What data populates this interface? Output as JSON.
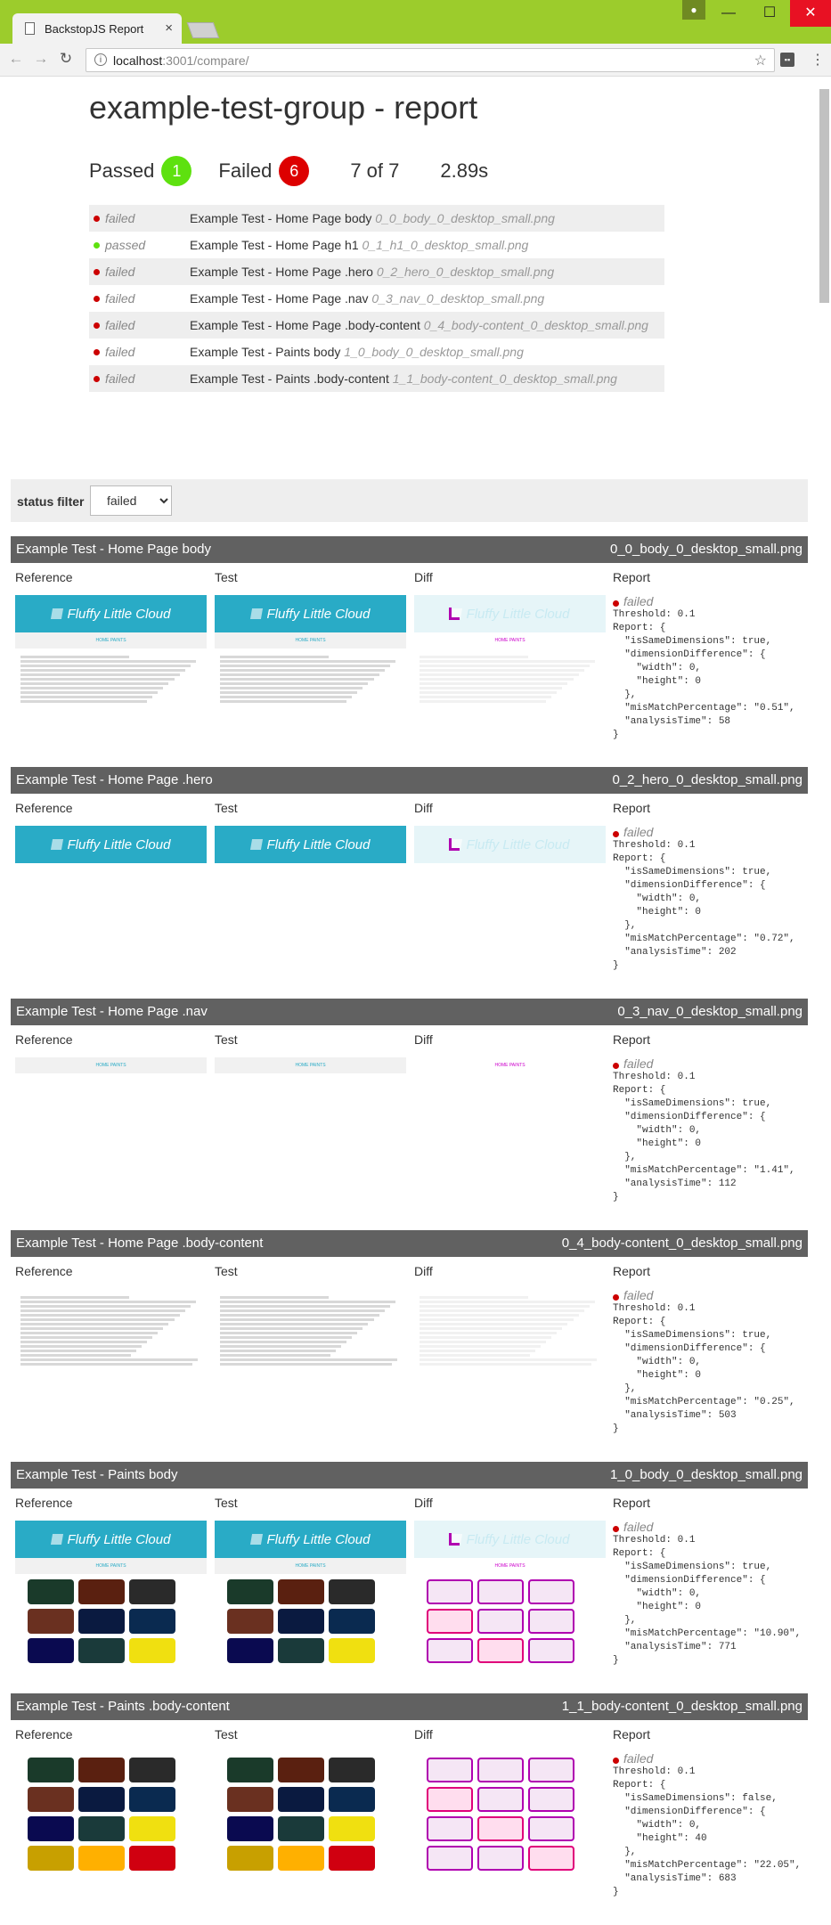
{
  "browser": {
    "tab_title": "BackstopJS Report",
    "url_host": "localhost",
    "url_path": ":3001/compare/"
  },
  "header": {
    "title": "example-test-group - report",
    "passed_label": "Passed",
    "passed_count": "1",
    "failed_label": "Failed",
    "failed_count": "6",
    "progress": "7 of 7",
    "time": "2.89s"
  },
  "summary_rows": [
    {
      "status": "failed",
      "name": "Example Test - Home Page body",
      "file": "0_0_body_0_desktop_small.png"
    },
    {
      "status": "passed",
      "name": "Example Test - Home Page h1",
      "file": "0_1_h1_0_desktop_small.png"
    },
    {
      "status": "failed",
      "name": "Example Test - Home Page .hero",
      "file": "0_2_hero_0_desktop_small.png"
    },
    {
      "status": "failed",
      "name": "Example Test - Home Page .nav",
      "file": "0_3_nav_0_desktop_small.png"
    },
    {
      "status": "failed",
      "name": "Example Test - Home Page .body-content",
      "file": "0_4_body-content_0_desktop_small.png"
    },
    {
      "status": "failed",
      "name": "Example Test - Paints body",
      "file": "1_0_body_0_desktop_small.png"
    },
    {
      "status": "failed",
      "name": "Example Test - Paints .body-content",
      "file": "1_1_body-content_0_desktop_small.png"
    }
  ],
  "filter": {
    "label": "status filter",
    "value": "failed"
  },
  "columns": {
    "reference": "Reference",
    "test": "Test",
    "diff": "Diff",
    "report": "Report"
  },
  "screenshot_texts": {
    "hero": "Fluffy Little Cloud",
    "nav": "HOME    PAINTS"
  },
  "tests": [
    {
      "name": "Example Test - Home Page body",
      "file": "0_0_body_0_desktop_small.png",
      "status": "failed",
      "report": "Threshold: 0.1\nReport: {\n  \"isSameDimensions\": true,\n  \"dimensionDifference\": {\n    \"width\": 0,\n    \"height\": 0\n  },\n  \"misMatchPercentage\": \"0.51\",\n  \"analysisTime\": 58\n}"
    },
    {
      "name": "Example Test - Home Page .hero",
      "file": "0_2_hero_0_desktop_small.png",
      "status": "failed",
      "report": "Threshold: 0.1\nReport: {\n  \"isSameDimensions\": true,\n  \"dimensionDifference\": {\n    \"width\": 0,\n    \"height\": 0\n  },\n  \"misMatchPercentage\": \"0.72\",\n  \"analysisTime\": 202\n}"
    },
    {
      "name": "Example Test - Home Page .nav",
      "file": "0_3_nav_0_desktop_small.png",
      "status": "failed",
      "report": "Threshold: 0.1\nReport: {\n  \"isSameDimensions\": true,\n  \"dimensionDifference\": {\n    \"width\": 0,\n    \"height\": 0\n  },\n  \"misMatchPercentage\": \"1.41\",\n  \"analysisTime\": 112\n}"
    },
    {
      "name": "Example Test - Home Page .body-content",
      "file": "0_4_body-content_0_desktop_small.png",
      "status": "failed",
      "report": "Threshold: 0.1\nReport: {\n  \"isSameDimensions\": true,\n  \"dimensionDifference\": {\n    \"width\": 0,\n    \"height\": 0\n  },\n  \"misMatchPercentage\": \"0.25\",\n  \"analysisTime\": 503\n}"
    },
    {
      "name": "Example Test - Paints body",
      "file": "1_0_body_0_desktop_small.png",
      "status": "failed",
      "report": "Threshold: 0.1\nReport: {\n  \"isSameDimensions\": true,\n  \"dimensionDifference\": {\n    \"width\": 0,\n    \"height\": 0\n  },\n  \"misMatchPercentage\": \"10.90\",\n  \"analysisTime\": 771\n}"
    },
    {
      "name": "Example Test - Paints .body-content",
      "file": "1_1_body-content_0_desktop_small.png",
      "status": "failed",
      "report": "Threshold: 0.1\nReport: {\n  \"isSameDimensions\": false,\n  \"dimensionDifference\": {\n    \"width\": 0,\n    \"height\": 40\n  },\n  \"misMatchPercentage\": \"22.05\",\n  \"analysisTime\": 683\n}"
    }
  ],
  "colors": {
    "passed": "#5ee10f",
    "failed": "#d00",
    "accent": "#29abc6",
    "chrome": "#9ccc2c"
  }
}
